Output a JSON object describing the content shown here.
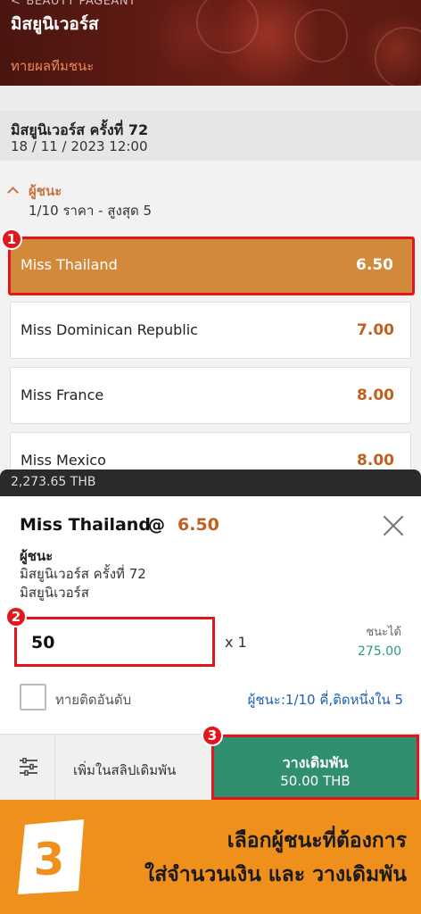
{
  "header": {
    "breadcrumb": "BEAUTY PAGEANT",
    "title": "มิสยูนิเวอร์ส",
    "subtitle": "ทายผลทีมชนะ"
  },
  "event": {
    "name": "มิสยูนิเวอร์ส ครั้งที่ 72",
    "datetime": "18 / 11 / 2023 12:00"
  },
  "market": {
    "label": "ผู้ชนะ",
    "info": "1/10 ราคา - สูงสุด 5"
  },
  "selections": [
    {
      "name": "Miss Thailand",
      "odds": "6.50",
      "selected": true
    },
    {
      "name": "Miss Dominican Republic",
      "odds": "7.00",
      "selected": false
    },
    {
      "name": "Miss France",
      "odds": "8.00",
      "selected": false
    },
    {
      "name": "Miss Mexico",
      "odds": "8.00",
      "selected": false
    }
  ],
  "balance": "2,273.65 THB",
  "betslip": {
    "selection": "Miss Thailand",
    "at": "@",
    "odds": "6.50",
    "market": "ผู้ชนะ",
    "event": "มิสยูนิเวอร์ส ครั้งที่ 72",
    "category": "มิสยูนิเวอร์ส",
    "stake": "50",
    "multiplier": "x 1",
    "win_label": "ชนะได้",
    "win_amount": "275.00",
    "checkbox_label": "ทายติดอันดับ",
    "terms_link": "ผู้ชนะ:1/10 คี่,ติดหนึ่งใน 5"
  },
  "actions": {
    "add_to_slip": "เพิ่มในสลิปเดิมพัน",
    "place_bet_label": "วางเดิมพัน",
    "place_bet_amount": "50.00 THB"
  },
  "annotations": {
    "badge1": "1",
    "badge2": "2",
    "badge3": "3"
  },
  "banner": {
    "step": "3",
    "line1": "เลือกผู้ชนะที่ต้องการ",
    "line2": "ใส่จำนวนเงิน และ วางเดิมพัน"
  },
  "colors": {
    "accent": "#d28a3a",
    "odds": "#c0601f",
    "highlight": "#e3151d",
    "place_bet": "#2f8f6e",
    "banner": "#f0901c"
  }
}
